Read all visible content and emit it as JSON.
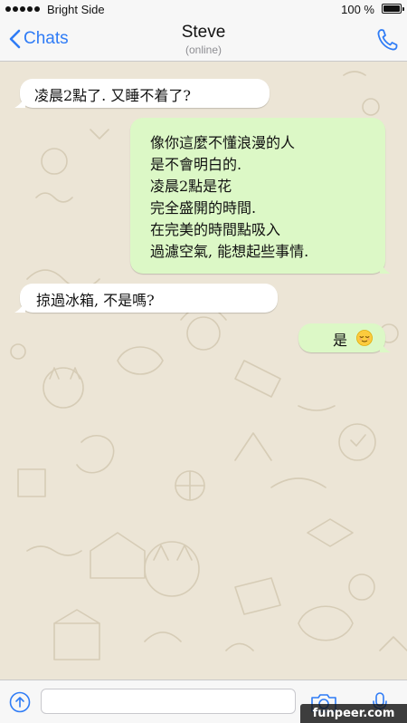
{
  "status_bar": {
    "carrier": "Bright Side",
    "battery_text": "100 %",
    "battery_level": 1.0
  },
  "nav": {
    "back_label": "Chats",
    "contact_name": "Steve",
    "contact_status": "(online)",
    "back_icon": "chevron-left-icon",
    "call_icon": "phone-icon"
  },
  "messages": [
    {
      "direction": "incoming",
      "text": "凌晨2點了. 又睡不着了?"
    },
    {
      "direction": "outgoing",
      "lines": [
        "像你這麼不懂浪漫的人",
        "是不會明白的.",
        "凌晨2點是花",
        "完全盛開的時間.",
        "在完美的時間點吸入",
        "過濾空氣, 能想起些事情."
      ]
    },
    {
      "direction": "incoming",
      "text": "掠過冰箱, 不是嗎?"
    },
    {
      "direction": "outgoing",
      "text": "是",
      "emoji": "relieved-face-emoji"
    }
  ],
  "input": {
    "value": "",
    "attach_icon": "share-up-arrow-icon",
    "camera_icon": "camera-icon",
    "mic_icon": "microphone-icon"
  },
  "watermark": "funpeer.com",
  "colors": {
    "accent": "#2f7cf6",
    "outgoing_bubble": "#dcf8c6",
    "incoming_bubble": "#ffffff",
    "wallpaper": "#ece5d6",
    "bar": "#f7f7f7"
  }
}
